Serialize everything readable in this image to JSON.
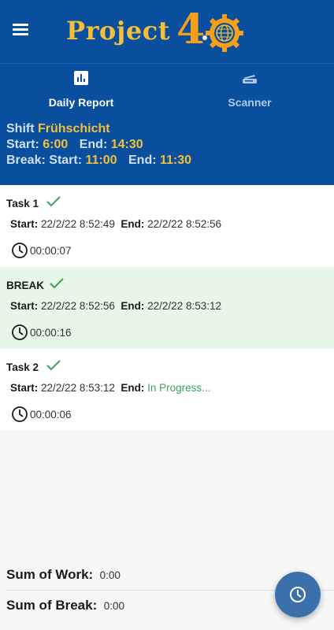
{
  "app": {
    "logo_text": "Project",
    "logo_version": "4",
    "brand_color": "#0a4e9e",
    "accent_color": "#f4bf3a"
  },
  "tabs": [
    {
      "label": "Daily Report",
      "icon": "bar-chart-icon",
      "active": true
    },
    {
      "label": "Scanner",
      "icon": "scanner-icon",
      "active": false
    }
  ],
  "shift": {
    "shift_label": "Shift",
    "shift_name": "Frühschicht",
    "start_label": "Start:",
    "start_value": "6:00",
    "end_label": "End:",
    "end_value": "14:30",
    "break_label": "Break:",
    "break_start_label": "Start:",
    "break_start_value": "11:00",
    "break_end_label": "End:",
    "break_end_value": "11:30"
  },
  "tasks": [
    {
      "name": "Task 1",
      "done": true,
      "start_label": "Start:",
      "start": "22/2/22 8:52:49",
      "end_label": "End:",
      "end": "22/2/22 8:52:56",
      "duration": "00:00:07"
    },
    {
      "name": "BREAK",
      "done": true,
      "start_label": "Start:",
      "start": "22/2/22 8:52:56",
      "end_label": "End:",
      "end": "22/2/22 8:53:12",
      "duration": "00:00:16"
    },
    {
      "name": "Task 2",
      "done": true,
      "start_label": "Start:",
      "start": "22/2/22 8:53:12",
      "end_label": "End:",
      "end": "In Progress...",
      "duration": "00:00:06"
    }
  ],
  "summary": {
    "work_label": "Sum of Work:",
    "work_value": "0:00",
    "break_label": "Sum of Break:",
    "break_value": "0:00"
  },
  "fab": {
    "icon": "clock-icon"
  },
  "colors": {
    "check": "#3aa35a",
    "progress": "#3aa35a",
    "break_bg": "#e8f5e9"
  }
}
